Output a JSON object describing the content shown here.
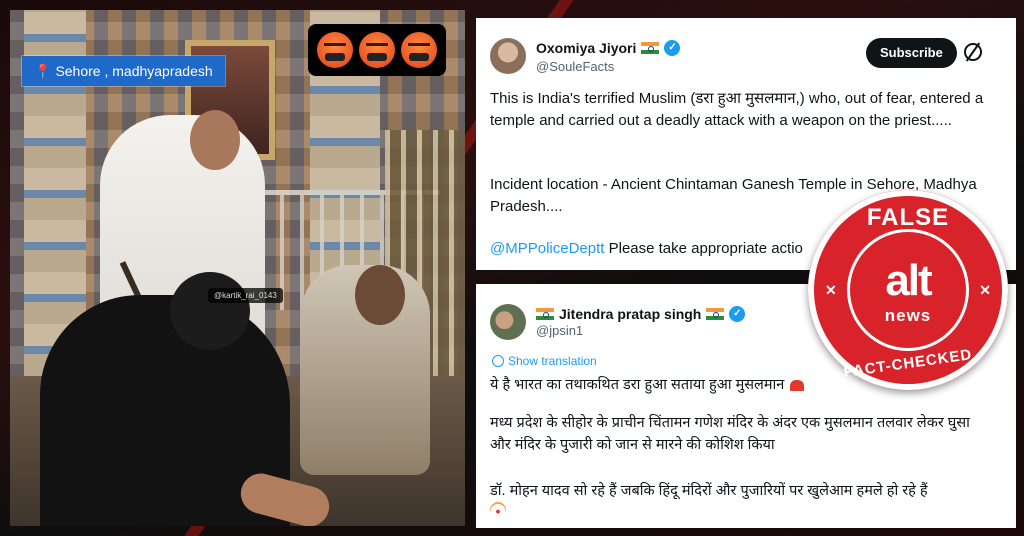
{
  "video": {
    "location_label": "Sehore , madhyapradesh",
    "watermark": "@kartik_rai_0143",
    "emojis": [
      "angry-face",
      "angry-face",
      "angry-face"
    ]
  },
  "tweet1": {
    "name": "Oxomiya Jiyori",
    "handle": "@SouleFacts",
    "subscribe_label": "Subscribe",
    "paragraph1": "This is India's terrified Muslim (डरा हुआ मुसलमान,) who, out of fear, entered a temple and carried out a deadly attack with a weapon on the priest.....",
    "paragraph2": "Incident location - Ancient Chintaman Ganesh Temple in Sehore, Madhya Pradesh....",
    "mention": "@MPPoliceDeptt",
    "paragraph3_rest": " Please take appropriate actio"
  },
  "tweet2": {
    "name": "Jitendra pratap singh",
    "handle": "@jpsin1",
    "show_translation": "Show translation",
    "line1": "ये है भारत का तथाकथित डरा हुआ सताया हुआ मुसलमान",
    "paragraph2": "मध्य प्रदेश के सीहोर के प्राचीन चिंतामन गणेश मंदिर के अंदर एक मुसलमान तलवार लेकर घुसा और मंदिर के पुजारी को जान से मारने की कोशिश किया",
    "paragraph3": "डॉ. मोहन यादव    सो रहे हैं जबकि हिंदू मंदिरों और पुजारियों पर खुलेआम हमले हो रहे हैं"
  },
  "stamp": {
    "top_text": "FALSE",
    "logo_alt": "alt",
    "logo_news": "news",
    "bottom_text": "FACT-CHECKED",
    "color": "#d9232a"
  },
  "colors": {
    "link": "#1d9bf0",
    "location_badge": "#1f69c9"
  }
}
